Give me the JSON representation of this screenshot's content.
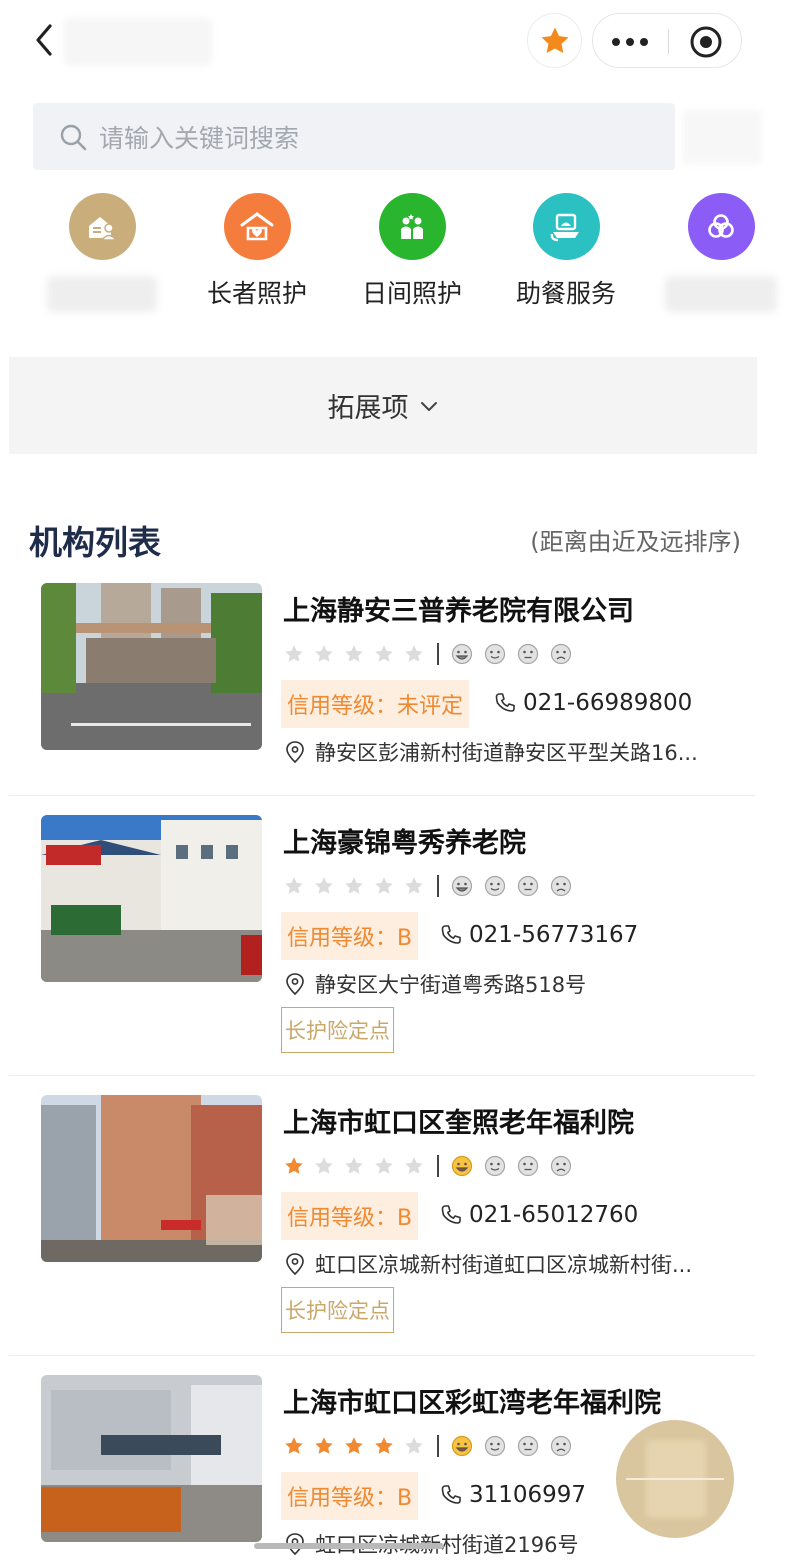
{
  "search": {
    "placeholder": "请输入关键词搜索"
  },
  "categories": [
    {
      "label": "",
      "icon": "home-user-icon",
      "color": "#c9ae7c"
    },
    {
      "label": "长者照护",
      "icon": "care-home-icon",
      "color": "#f47c3c"
    },
    {
      "label": "日间照护",
      "icon": "family-icon",
      "color": "#2ab52f"
    },
    {
      "label": "助餐服务",
      "icon": "meal-tray-icon",
      "color": "#2bc0c2"
    },
    {
      "label": "",
      "icon": "circles-icon",
      "color": "#8b5cf6"
    }
  ],
  "expand": {
    "label": "拓展项"
  },
  "list": {
    "title": "机构列表",
    "sort_note": "(距离由近及远排序)"
  },
  "items": [
    {
      "name": "上海静安三普养老院有限公司",
      "stars": 0,
      "credit": "信用等级：未评定",
      "phone": "021-66989800",
      "address": "静安区彭浦新村街道静安区平型关路16...",
      "tag": ""
    },
    {
      "name": "上海豪锦粤秀养老院",
      "stars": 0,
      "credit": "信用等级：B",
      "phone": "021-56773167",
      "address": "静安区大宁街道粤秀路518号",
      "tag": "长护险定点"
    },
    {
      "name": "上海市虹口区奎照老年福利院",
      "stars": 1,
      "credit": "信用等级：B",
      "phone": "021-65012760",
      "address": "虹口区凉城新村街道虹口区凉城新村街...",
      "tag": "长护险定点"
    },
    {
      "name": "上海市虹口区彩虹湾老年福利院",
      "stars": 4,
      "credit": "信用等级：B",
      "phone": "31106997",
      "address": "虹口区凉城新村街道2196号",
      "tag": ""
    }
  ],
  "colors": {
    "accent": "#f0892f",
    "credit_bg": "#fdeee0",
    "tag_border": "#c9a86a",
    "list_title": "#1f2d4a"
  }
}
